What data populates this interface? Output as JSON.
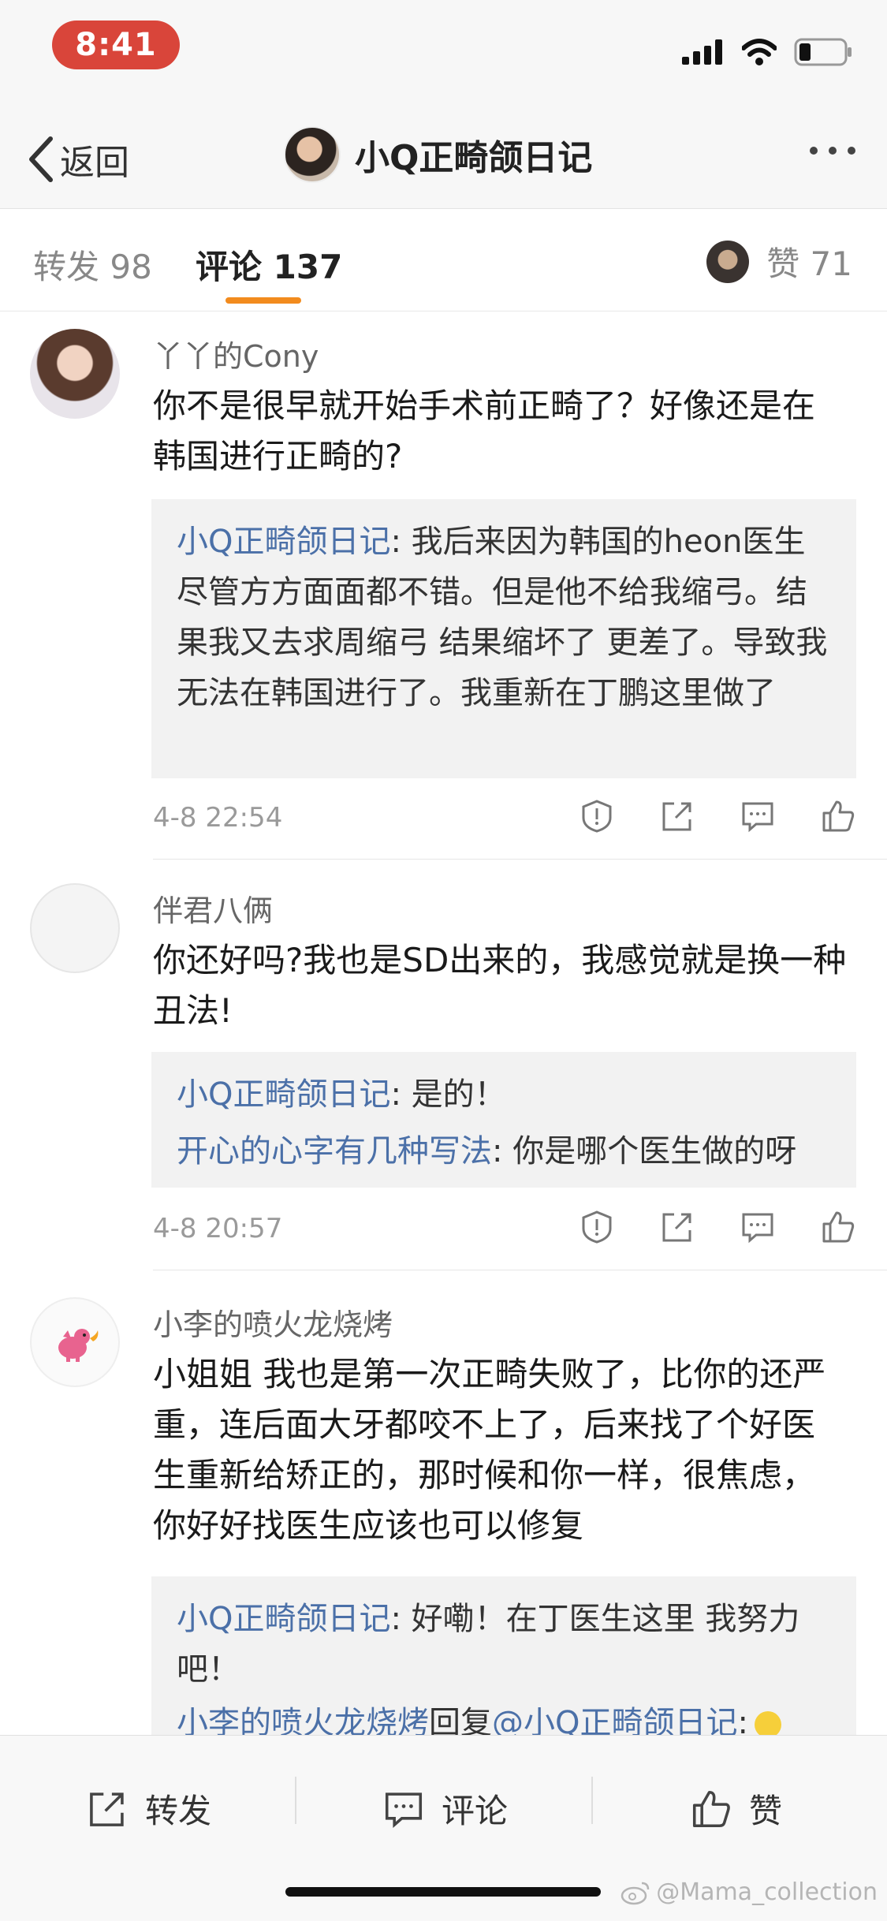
{
  "status_bar": {
    "time": "8:41"
  },
  "nav": {
    "back_label": "返回",
    "title": "小Q正畸颌日记"
  },
  "tabs": {
    "repost": "转发 98",
    "comments": "评论 137",
    "likes": "赞 71"
  },
  "comments": [
    {
      "user": "丫丫的Cony",
      "text": "你不是很早就开始手术前正畸了？好像还是在韩国进行正畸的?",
      "replies": [
        {
          "name": "小Q正畸颌日记",
          "text": ": 我后来因为韩国的heon医生尽管方方面面都不错。但是他不给我缩弓。结果我又去求周缩弓 结果缩坏了 更差了。导致我无法在韩国进行了。我重新在丁鹏这里做了"
        }
      ],
      "time": "4-8 22:54"
    },
    {
      "user": "伴君八俩",
      "text": "你还好吗?我也是SD出来的，我感觉就是换一种丑法!",
      "replies": [
        {
          "name": "小Q正畸颌日记",
          "text": ": 是的！"
        },
        {
          "name": "开心的心字有几种写法",
          "text": ": 你是哪个医生做的呀"
        }
      ],
      "time": "4-8 20:57"
    },
    {
      "user": "小李的喷火龙烧烤",
      "text": "小姐姐 我也是第一次正畸失败了，比你的还严重，连后面大牙都咬不上了，后来找了个好医生重新给矫正的，那时候和你一样，很焦虑，你好好找医生应该也可以修复",
      "replies": [
        {
          "name": "小Q正畸颌日记",
          "text": ": 好嘞！在丁医生这里 我努力吧！"
        },
        {
          "name": "小李的喷火龙烧烤",
          "mid": "回复",
          "mention": "@小Q正畸颌日记",
          "text": ":"
        }
      ]
    }
  ],
  "bottom_bar": {
    "repost": "转发",
    "comment": "评论",
    "like": "赞"
  },
  "watermark": "@Mama_collection"
}
